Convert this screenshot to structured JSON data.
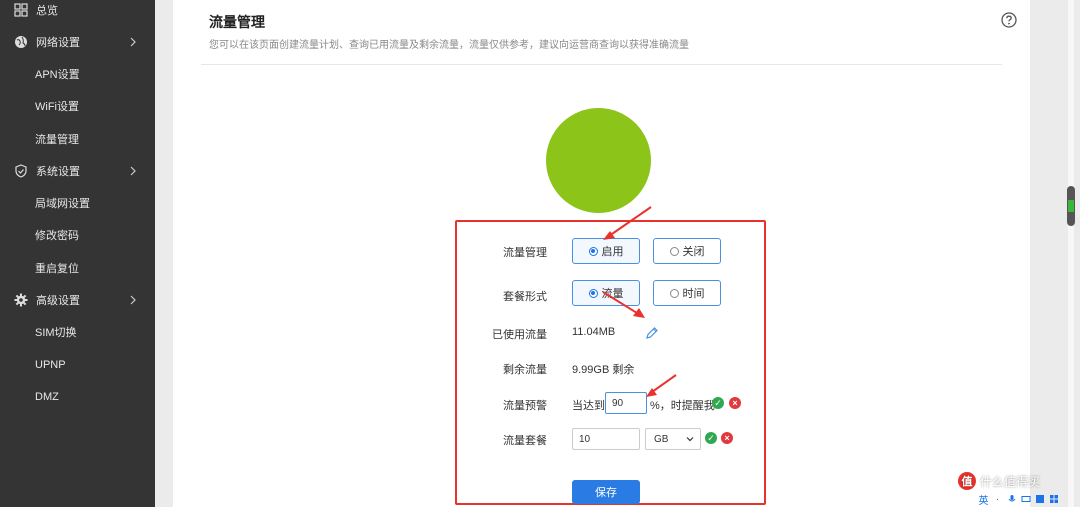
{
  "sidebar": {
    "items": [
      {
        "label": "总览",
        "icon": "dashboard-icon",
        "kind": "top"
      },
      {
        "label": "网络设置",
        "icon": "globe-icon",
        "kind": "top",
        "expandable": true
      },
      {
        "label": "APN设置",
        "kind": "sub"
      },
      {
        "label": "WiFi设置",
        "kind": "sub"
      },
      {
        "label": "流量管理",
        "kind": "sub"
      },
      {
        "label": "系统设置",
        "icon": "shield-icon",
        "kind": "top",
        "expandable": true
      },
      {
        "label": "局域网设置",
        "kind": "sub"
      },
      {
        "label": "修改密码",
        "kind": "sub"
      },
      {
        "label": "重启复位",
        "kind": "sub"
      },
      {
        "label": "高级设置",
        "icon": "gear-icon",
        "kind": "top",
        "expandable": true
      },
      {
        "label": "SIM切换",
        "kind": "sub"
      },
      {
        "label": "UPNP",
        "kind": "sub"
      },
      {
        "label": "DMZ",
        "kind": "sub"
      }
    ]
  },
  "header": {
    "title": "流量管理",
    "description": "您可以在该页面创建流量计划、查询已用流量及剩余流量，流量仅供参考，建议向运营商查询以获得准确流量",
    "help_icon": "question-circle-icon"
  },
  "status_circle_color": "#8dc41a",
  "form": {
    "traffic_mgmt": {
      "label": "流量管理",
      "options": [
        "启用",
        "关闭"
      ],
      "selected": "启用"
    },
    "plan_type": {
      "label": "套餐形式",
      "options": [
        "流量",
        "时间"
      ],
      "selected": "流量"
    },
    "used": {
      "label": "已使用流量",
      "value": "11.04MB"
    },
    "remaining": {
      "label": "剩余流量",
      "value": "9.99GB 剩余"
    },
    "alert": {
      "label": "流量预警",
      "prefix": "当达到",
      "value": "90",
      "suffix": "%，时提醒我"
    },
    "plan": {
      "label": "流量套餐",
      "value": "10",
      "unit": "GB"
    },
    "save_label": "保存"
  },
  "watermark": {
    "text": "什么值得买",
    "logo": "值"
  },
  "ime": {
    "lang": "英"
  },
  "colors": {
    "accent": "#2a7be4",
    "highlight_box": "#e8322b",
    "ok": "#2fa84f",
    "cancel": "#e0393e"
  }
}
